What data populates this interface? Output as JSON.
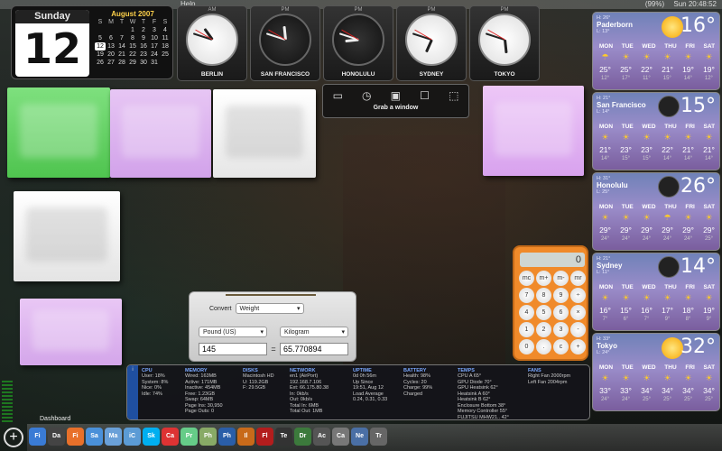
{
  "menubar": {
    "help": "Help",
    "clock": "Sun 20:48:52",
    "battery": "(99%)"
  },
  "calendar": {
    "day_name": "Sunday",
    "day_number": "12",
    "month_title": "August 2007",
    "weekdays": [
      "S",
      "M",
      "T",
      "W",
      "T",
      "F",
      "S"
    ],
    "weeks": [
      [
        "",
        "",
        "",
        "1",
        "2",
        "3",
        "4"
      ],
      [
        "5",
        "6",
        "7",
        "8",
        "9",
        "10",
        "11"
      ],
      [
        "12",
        "13",
        "14",
        "15",
        "16",
        "17",
        "18"
      ],
      [
        "19",
        "20",
        "21",
        "22",
        "23",
        "24",
        "25"
      ],
      [
        "26",
        "27",
        "28",
        "29",
        "30",
        "31",
        ""
      ]
    ],
    "today": "12"
  },
  "clocks": [
    {
      "city": "BERLIN",
      "period": "AM",
      "face": "light",
      "hour": 10,
      "minute": 48
    },
    {
      "city": "SAN FRANCISCO",
      "period": "PM",
      "face": "dark",
      "hour": 11,
      "minute": 48
    },
    {
      "city": "HONOLULU",
      "period": "PM",
      "face": "dark",
      "hour": 8,
      "minute": 48
    },
    {
      "city": "SYDNEY",
      "period": "PM",
      "face": "light",
      "hour": 6,
      "minute": 48
    },
    {
      "city": "TOKYO",
      "period": "PM",
      "face": "light",
      "hour": 5,
      "minute": 48
    }
  ],
  "grab": {
    "label": "Grab a window",
    "icons": [
      "screen-icon",
      "timer-icon",
      "camera-icon",
      "window-icon",
      "selection-icon"
    ]
  },
  "converter": {
    "label": "Convert",
    "category": "Weight",
    "from_unit": "Pound (US)",
    "to_unit": "Kilogram",
    "from_value": "145",
    "equals": "=",
    "to_value": "65.770894"
  },
  "calculator": {
    "display": "0",
    "keys": [
      "mc",
      "m+",
      "m-",
      "mr",
      "7",
      "8",
      "9",
      "÷",
      "4",
      "5",
      "6",
      "×",
      "1",
      "2",
      "3",
      "-",
      "0",
      ".",
      "c",
      "+"
    ]
  },
  "weather": [
    {
      "city": "Paderborn",
      "hi": "H: 26°",
      "lo": "L: 13°",
      "temp": "16°",
      "kind": "sun",
      "days": [
        "MON",
        "TUE",
        "WED",
        "THU",
        "FRI",
        "SAT"
      ],
      "icons": [
        "☂",
        "☀",
        "☀",
        "☀",
        "☀",
        "☀"
      ],
      "highs": [
        "25°",
        "25°",
        "22°",
        "21°",
        "19°",
        "19°"
      ],
      "lows": [
        "12°",
        "17°",
        "11°",
        "15°",
        "14°",
        "12°"
      ]
    },
    {
      "city": "San Francisco",
      "hi": "H: 21°",
      "lo": "L: 14°",
      "temp": "15°",
      "kind": "moon",
      "days": [
        "MON",
        "TUE",
        "WED",
        "THU",
        "FRI",
        "SAT"
      ],
      "icons": [
        "☀",
        "☀",
        "☀",
        "☀",
        "☀",
        "☀"
      ],
      "highs": [
        "21°",
        "23°",
        "23°",
        "22°",
        "21°",
        "21°"
      ],
      "lows": [
        "14°",
        "15°",
        "15°",
        "14°",
        "14°",
        "14°"
      ]
    },
    {
      "city": "Honolulu",
      "hi": "H: 31°",
      "lo": "L: 25°",
      "temp": "26°",
      "kind": "moon",
      "days": [
        "MON",
        "TUE",
        "WED",
        "THU",
        "FRI",
        "SAT"
      ],
      "icons": [
        "☀",
        "☀",
        "☀",
        "☂",
        "☀",
        "☀"
      ],
      "highs": [
        "29°",
        "29°",
        "29°",
        "29°",
        "29°",
        "29°"
      ],
      "lows": [
        "24°",
        "24°",
        "24°",
        "24°",
        "24°",
        "25°"
      ]
    },
    {
      "city": "Sydney",
      "hi": "H: 21°",
      "lo": "L: 11°",
      "temp": "14°",
      "kind": "moon",
      "days": [
        "MON",
        "TUE",
        "WED",
        "THU",
        "FRI",
        "SAT"
      ],
      "icons": [
        "☀",
        "☀",
        "☀",
        "☀",
        "☀",
        "☀"
      ],
      "highs": [
        "16°",
        "15°",
        "16°",
        "17°",
        "18°",
        "19°"
      ],
      "lows": [
        "7°",
        "6°",
        "7°",
        "9°",
        "8°",
        "9°"
      ]
    },
    {
      "city": "Tokyo",
      "hi": "H: 33°",
      "lo": "L: 24°",
      "temp": "32°",
      "kind": "sun",
      "days": [
        "MON",
        "TUE",
        "WED",
        "THU",
        "FRI",
        "SAT"
      ],
      "icons": [
        "☀",
        "☀",
        "☀",
        "☀",
        "☀",
        "☀"
      ],
      "highs": [
        "33°",
        "33°",
        "34°",
        "34°",
        "34°",
        "34°"
      ],
      "lows": [
        "24°",
        "24°",
        "25°",
        "25°",
        "25°",
        "25°"
      ]
    }
  ],
  "istat": {
    "cpu": {
      "h": "CPU",
      "lines": [
        "User: 18%",
        "System: 8%",
        "Nice: 0%",
        "Idle: 74%"
      ]
    },
    "memory": {
      "h": "MEMORY",
      "lines": [
        "Wired: 163MB",
        "Active: 171MB",
        "Inactive: 454MB",
        "Free: 1.23GB",
        "Swap: 64MB",
        "Page Ins: 30,950",
        "Page Outs: 0"
      ]
    },
    "disks": {
      "h": "DISKS",
      "lines": [
        "Macintosh HD",
        "U: 119.2GB",
        "F: 29.5GB"
      ]
    },
    "network": {
      "h": "NETWORK",
      "lines": [
        "en1 (AirPort)",
        "192.168.7.106",
        "Ext: 66.175.80.38",
        "In: 0kb/s",
        "Out: 0kb/s",
        "Total In: 6MB",
        "Total Out: 1MB"
      ]
    },
    "uptime": {
      "h": "UPTIME",
      "lines": [
        "0d 0h 56m",
        "Up Since",
        "19:51, Aug 12",
        "Load Average",
        "0.24, 0.31, 0.33"
      ]
    },
    "battery": {
      "h": "BATTERY",
      "lines": [
        "Health: 98%",
        "Cycles: 20",
        "Charge: 99%",
        "Charged"
      ]
    },
    "temps": {
      "h": "TEMPS",
      "lines": [
        "CPU A 65°",
        "GPU Diode 70°",
        "GPU Heatsink 62°",
        "Heatsink A 60°",
        "Heatsink B 62°",
        "Enclosure Bottom 38°",
        "Memory Controller 55°",
        "FUJITSU MHW21.. 42°"
      ]
    },
    "fans": {
      "h": "FANS",
      "lines": [
        "Right Fan 2000rpm",
        "Left Fan 2004rpm"
      ]
    }
  },
  "dock": {
    "label": "Dashboard",
    "items": [
      "Finder",
      "Dashboard",
      "Firefox",
      "Safari",
      "Mail",
      "iChat",
      "Skype",
      "Calendar",
      "Preview",
      "Photo",
      "Photoshop",
      "Illustrator",
      "Flash",
      "Terminal",
      "Dreamweaver",
      "Activity",
      "Calculator",
      "Network",
      "Trash"
    ]
  }
}
